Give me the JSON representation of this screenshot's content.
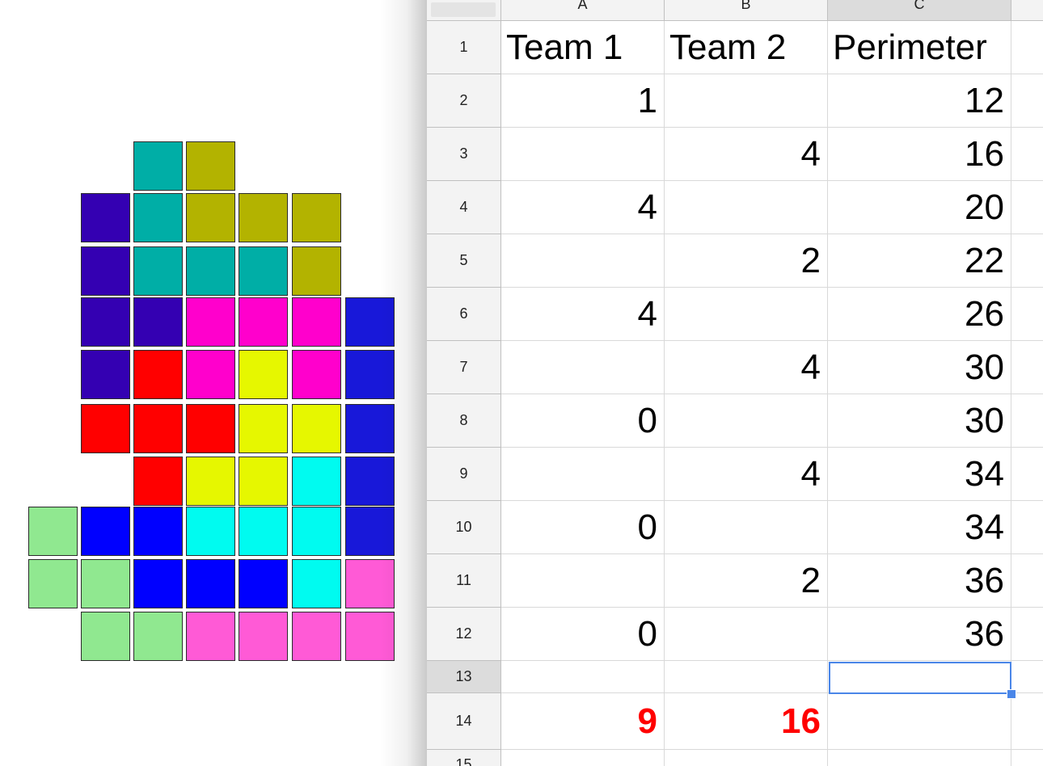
{
  "board": {
    "colors": {
      "teal": "#00aea6",
      "olive": "#b3b300",
      "indigo": "#3400b2",
      "magenta": "#ff00cc",
      "royal": "#1818d9",
      "red": "#ff0000",
      "yellow": "#e6f700",
      "cyan": "#00fbf0",
      "lightgreen": "#90e890",
      "blue": "#0000ff",
      "pink": "#ff5ad6"
    },
    "grid": [
      [
        "",
        "",
        "teal",
        "olive",
        "",
        "",
        ""
      ],
      [
        "",
        "indigo",
        "teal",
        "olive",
        "olive",
        "olive",
        ""
      ],
      [
        "",
        "indigo",
        "teal",
        "teal",
        "teal",
        "olive",
        ""
      ],
      [
        "",
        "indigo",
        "indigo",
        "magenta",
        "magenta",
        "magenta",
        "royal"
      ],
      [
        "",
        "indigo",
        "red",
        "magenta",
        "yellow",
        "magenta",
        "royal"
      ],
      [
        "",
        "red",
        "red",
        "red",
        "yellow",
        "yellow",
        "royal"
      ],
      [
        "",
        "",
        "red",
        "yellow",
        "yellow",
        "cyan",
        "royal"
      ],
      [
        "lightgreen",
        "blue",
        "blue",
        "cyan",
        "cyan",
        "cyan",
        "royal"
      ],
      [
        "lightgreen",
        "lightgreen",
        "blue",
        "blue",
        "blue",
        "cyan",
        "pink"
      ],
      [
        "",
        "lightgreen",
        "lightgreen",
        "pink",
        "pink",
        "pink",
        "pink"
      ]
    ]
  },
  "sheet": {
    "column_headers": [
      "A",
      "B",
      "C"
    ],
    "active_column": "C",
    "active_row": "13",
    "selected_cell": "C13",
    "rows": [
      {
        "n": "1",
        "a": "Team 1",
        "b": "Team 2",
        "c": "Perimeter"
      },
      {
        "n": "2",
        "a": "1",
        "b": "",
        "c": "12"
      },
      {
        "n": "3",
        "a": "",
        "b": "4",
        "c": "16"
      },
      {
        "n": "4",
        "a": "4",
        "b": "",
        "c": "20"
      },
      {
        "n": "5",
        "a": "",
        "b": "2",
        "c": "22"
      },
      {
        "n": "6",
        "a": "4",
        "b": "",
        "c": "26"
      },
      {
        "n": "7",
        "a": "",
        "b": "4",
        "c": "30"
      },
      {
        "n": "8",
        "a": "0",
        "b": "",
        "c": "30"
      },
      {
        "n": "9",
        "a": "",
        "b": "4",
        "c": "34"
      },
      {
        "n": "10",
        "a": "0",
        "b": "",
        "c": "34"
      },
      {
        "n": "11",
        "a": "",
        "b": "2",
        "c": "36"
      },
      {
        "n": "12",
        "a": "0",
        "b": "",
        "c": "36"
      },
      {
        "n": "13",
        "a": "",
        "b": "",
        "c": ""
      },
      {
        "n": "14",
        "a": "9",
        "b": "16",
        "c": ""
      },
      {
        "n": "15",
        "a": "",
        "b": "",
        "c": ""
      }
    ],
    "total_color": "#ff0000",
    "selection_color": "#4a86e8"
  }
}
